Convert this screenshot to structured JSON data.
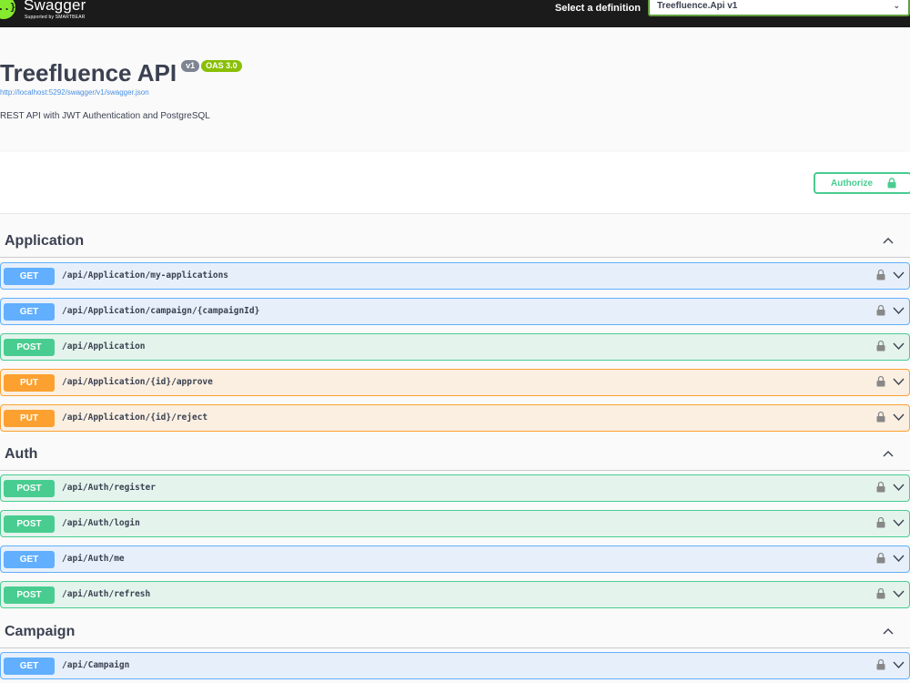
{
  "topbar": {
    "logo_text": "Swagger",
    "logo_mark": "{..}",
    "logo_sub": "Supported by SMARTBEAR",
    "select_label": "Select a definition",
    "definition_selected": "Treefluence.Api v1"
  },
  "info": {
    "title": "Treefluence API",
    "version_badge": "v1",
    "oas_badge": "OAS 3.0",
    "spec_url": "http://localhost:5292/swagger/v1/swagger.json",
    "description": "REST API with JWT Authentication and PostgreSQL"
  },
  "authorize": {
    "label": "Authorize",
    "icon": "lock-icon"
  },
  "colors": {
    "get": "#61affe",
    "post": "#49cc90",
    "put": "#fca130",
    "topbar": "#1b1b1b",
    "accent": "#85ea2d"
  },
  "tags": [
    {
      "name": "Application",
      "operations": [
        {
          "method": "GET",
          "path": "/api/Application/my-applications"
        },
        {
          "method": "GET",
          "path": "/api/Application/campaign/{campaignId}"
        },
        {
          "method": "POST",
          "path": "/api/Application"
        },
        {
          "method": "PUT",
          "path": "/api/Application/{id}/approve"
        },
        {
          "method": "PUT",
          "path": "/api/Application/{id}/reject"
        }
      ]
    },
    {
      "name": "Auth",
      "operations": [
        {
          "method": "POST",
          "path": "/api/Auth/register"
        },
        {
          "method": "POST",
          "path": "/api/Auth/login"
        },
        {
          "method": "GET",
          "path": "/api/Auth/me"
        },
        {
          "method": "POST",
          "path": "/api/Auth/refresh"
        }
      ]
    },
    {
      "name": "Campaign",
      "operations": [
        {
          "method": "GET",
          "path": "/api/Campaign"
        }
      ]
    }
  ]
}
